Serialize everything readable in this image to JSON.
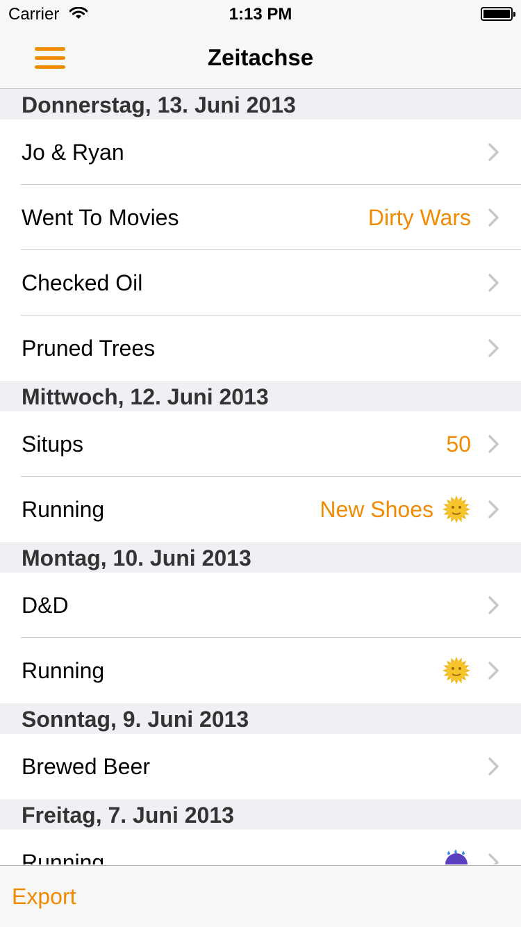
{
  "status_bar": {
    "carrier": "Carrier",
    "time": "1:13 PM"
  },
  "nav": {
    "title": "Zeitachse",
    "menu_icon": "hamburger-icon"
  },
  "accent_color": "#f08a00",
  "sections": [
    {
      "header": "Donnerstag, 13. Juni 2013",
      "rows": [
        {
          "title": "Jo & Ryan",
          "detail": "",
          "icon": ""
        },
        {
          "title": "Went To Movies",
          "detail": "Dirty Wars",
          "icon": ""
        },
        {
          "title": "Checked Oil",
          "detail": "",
          "icon": ""
        },
        {
          "title": "Pruned Trees",
          "detail": "",
          "icon": ""
        }
      ]
    },
    {
      "header": "Mittwoch, 12. Juni 2013",
      "rows": [
        {
          "title": "Situps",
          "detail": "50",
          "icon": ""
        },
        {
          "title": "Running",
          "detail": "New Shoes",
          "icon": "sun-face-icon"
        }
      ]
    },
    {
      "header": "Montag, 10. Juni 2013",
      "rows": [
        {
          "title": "D&D",
          "detail": "",
          "icon": ""
        },
        {
          "title": "Running",
          "detail": "",
          "icon": "sun-face-icon"
        }
      ]
    },
    {
      "header": "Sonntag, 9. Juni 2013",
      "rows": [
        {
          "title": "Brewed Beer",
          "detail": "",
          "icon": ""
        }
      ]
    },
    {
      "header": "Freitag, 7. Juni 2013",
      "rows": [
        {
          "title": "Running",
          "detail": "",
          "icon": "rain-umbrella-icon"
        }
      ]
    }
  ],
  "toolbar": {
    "export_label": "Export"
  }
}
